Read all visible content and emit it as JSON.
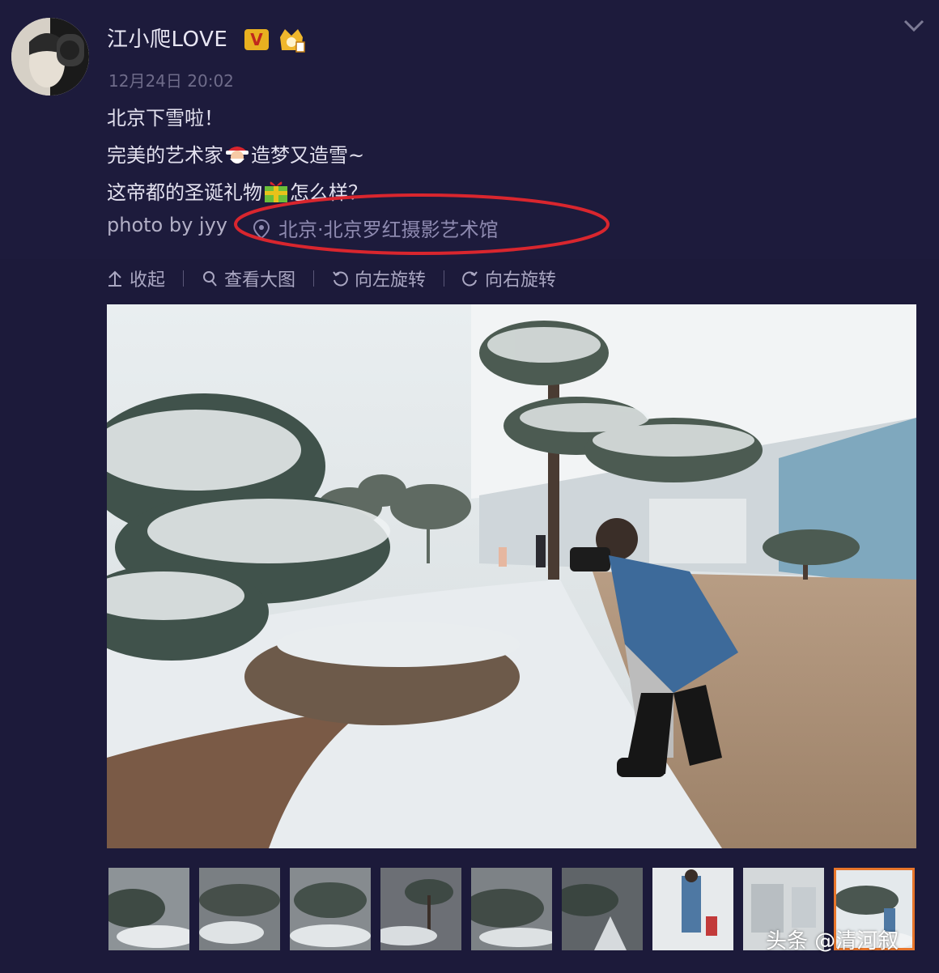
{
  "post": {
    "username": "江小爬LOVE",
    "verified_badge": "V",
    "timestamp": "12月24日 20:02",
    "line1": "北京下雪啦！",
    "line2_a": "完美的艺术家",
    "line2_b": "造梦又造雪~",
    "line3_a": "这帝都的圣诞礼物",
    "line3_b": "怎么样？",
    "photo_credit": "photo by jyy",
    "location": "北京·北京罗红摄影艺术馆"
  },
  "toolbar": {
    "collapse": "收起",
    "view_large": "查看大图",
    "rotate_left": "向左旋转",
    "rotate_right": "向右旋转"
  },
  "thumbnails": {
    "count": 9,
    "active_index": 9
  },
  "watermark": "头条 @清河叙",
  "colors": {
    "background": "#1c1a3a",
    "annotation_circle": "#d9262e",
    "active_thumb_border": "#e8752a",
    "verified_badge": "#e8b020"
  }
}
